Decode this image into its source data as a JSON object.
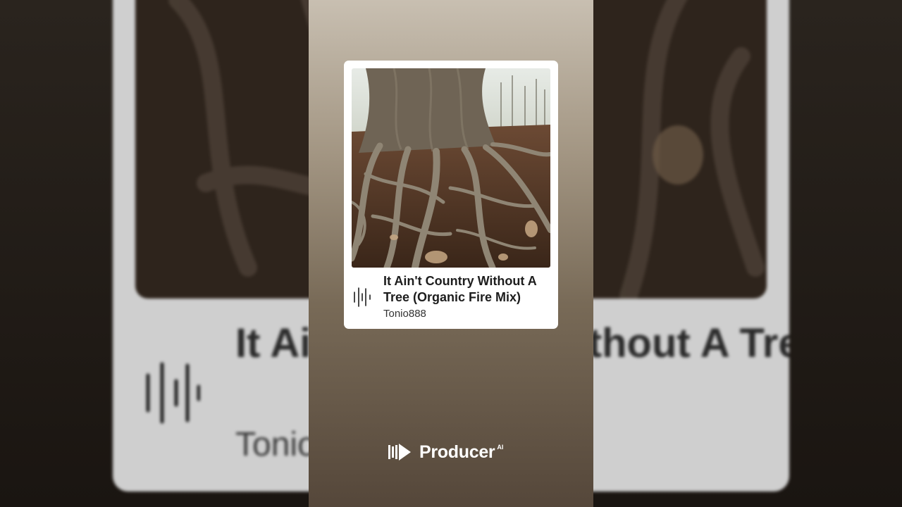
{
  "track": {
    "title": "It Ain't Country Without A Tree (Organic Fire Mix)",
    "artist": "Tonio888"
  },
  "brand": {
    "name": "Producer",
    "suffix": "AI"
  },
  "colors": {
    "card_background": "#ffffff",
    "phone_gradient_top": "#c8bfb1",
    "phone_gradient_bottom": "#55473a",
    "title_text": "#1d1d1d",
    "brand_text": "#ffffff"
  },
  "icons": {
    "waveform": "waveform-icon",
    "brand_logo": "producer-logo-icon"
  }
}
